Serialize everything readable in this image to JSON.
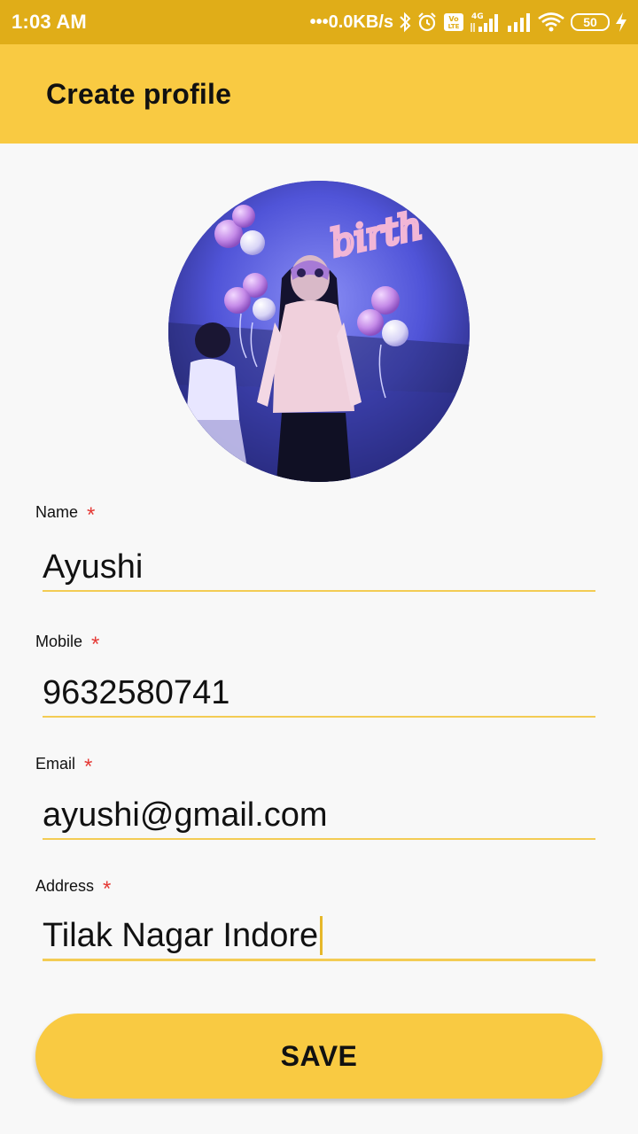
{
  "status_bar": {
    "time": "1:03 AM",
    "network_speed": "•••0.0KB/s",
    "battery_level": "50",
    "icons": [
      "bluetooth-icon",
      "alarm-icon",
      "volte-icon",
      "signal-4g-icon",
      "signal-icon",
      "wifi-icon",
      "battery-icon",
      "charging-icon"
    ],
    "volte_text": "Vo\nLTE",
    "network_type": "4G"
  },
  "app_bar": {
    "title": "Create profile",
    "color": "#f9ca42"
  },
  "avatar": {
    "balloon_text": "birth"
  },
  "form": {
    "name": {
      "label": "Name",
      "required_mark": "*",
      "value": "Ayushi"
    },
    "mobile": {
      "label": "Mobile",
      "required_mark": "*",
      "value": "9632580741"
    },
    "email": {
      "label": "Email",
      "required_mark": "*",
      "value": "ayushi@gmail.com"
    },
    "address": {
      "label": "Address",
      "required_mark": "*",
      "value": "Tilak Nagar Indore",
      "focused": true
    }
  },
  "save_button": {
    "label": "SAVE"
  },
  "colors": {
    "status_bar": "#e0ad18",
    "accent": "#f9ca42",
    "underline": "#f3cc54",
    "required": "#e53935",
    "background": "#f8f8f8"
  }
}
